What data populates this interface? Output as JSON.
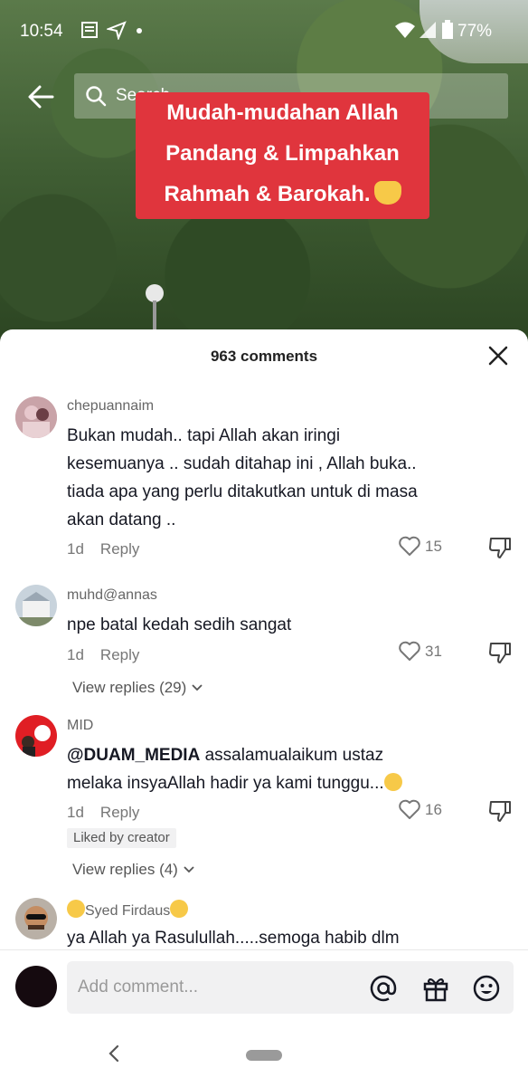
{
  "status_bar": {
    "time": "10:54",
    "battery": "77%"
  },
  "search": {
    "placeholder": "Search"
  },
  "video_overlay": {
    "line1": "Mudah-mudahan Allah",
    "line2": "Pandang & Limpahkan",
    "line3": "Rahmah & Barokah."
  },
  "sheet": {
    "title": "963 comments"
  },
  "comments": [
    {
      "username": "chepuannaim",
      "text_lines": [
        "Bukan mudah.. tapi Allah akan iringi",
        "kesemuanya .. sudah ditahap ini , Allah buka..",
        "tiada apa yang perlu ditakutkan untuk di masa",
        "akan datang .."
      ],
      "age": "1d",
      "reply": "Reply",
      "likes": "15"
    },
    {
      "username": "muhd@annas",
      "text": "npe batal kedah sedih sangat",
      "age": "1d",
      "reply": "Reply",
      "likes": "31",
      "view_replies": "View replies (29)"
    },
    {
      "username": "MID",
      "mention": "@DUAM_MEDIA",
      "text_line1": " assalamualaikum ustaz",
      "text_line2": "melaka insyaAllah hadir ya kami tunggu...",
      "age": "1d",
      "reply": "Reply",
      "likes": "16",
      "badge": "Liked by creator",
      "view_replies": "View replies (4)"
    },
    {
      "username": "Syed Firdaus",
      "text": "ya Allah ya Rasulullah.....semoga habib dlm"
    }
  ],
  "composer": {
    "placeholder": "Add comment..."
  },
  "colors": {
    "overlay_red": "#e0353d",
    "text_dark": "#161823",
    "meta_gray": "#777777"
  }
}
